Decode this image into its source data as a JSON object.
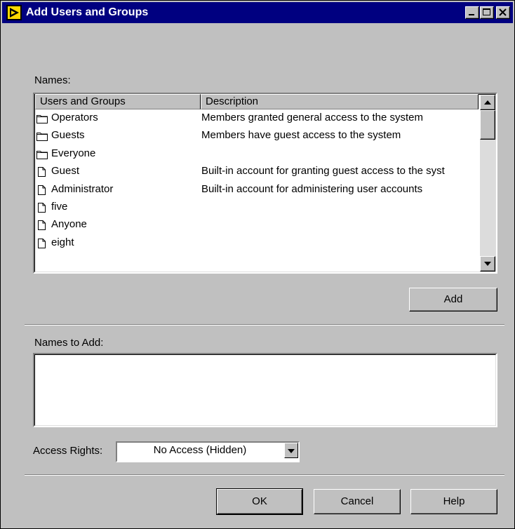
{
  "window": {
    "title": "Add Users and Groups"
  },
  "names": {
    "label": "Names:",
    "columns": [
      "Users and Groups",
      "Description"
    ],
    "rows": [
      {
        "type": "folder",
        "name": "Operators",
        "description": "Members granted general access to the system"
      },
      {
        "type": "folder",
        "name": "Guests",
        "description": "Members have guest access to the system"
      },
      {
        "type": "folder",
        "name": "Everyone",
        "description": ""
      },
      {
        "type": "file",
        "name": "Guest",
        "description": "Built-in account for granting guest access to the syst"
      },
      {
        "type": "file",
        "name": "Administrator",
        "description": "Built-in account for administering user accounts"
      },
      {
        "type": "file",
        "name": "five",
        "description": ""
      },
      {
        "type": "file",
        "name": "Anyone",
        "description": ""
      },
      {
        "type": "file",
        "name": "eight",
        "description": ""
      }
    ],
    "add_button": "Add"
  },
  "names_to_add": {
    "label": "Names to Add:",
    "value": ""
  },
  "access_rights": {
    "label": "Access Rights:",
    "selected": "No Access (Hidden)"
  },
  "buttons": {
    "ok": "OK",
    "cancel": "Cancel",
    "help": "Help"
  },
  "icons": {
    "app": "labview-run-icon",
    "minimize": "minimize-icon",
    "maximize": "maximize-icon",
    "close": "close-icon",
    "folder": "folder-icon",
    "file": "file-icon"
  },
  "colors": {
    "titlebar": "#000080",
    "face": "#c0c0c0",
    "app_icon": "#ffd800"
  }
}
